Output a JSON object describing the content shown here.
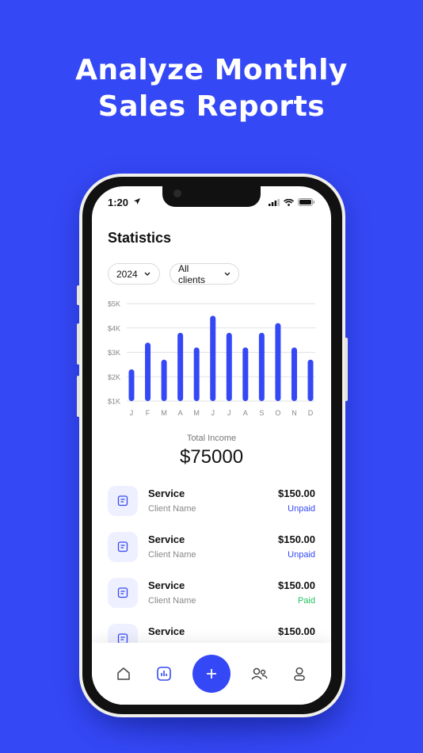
{
  "headline": {
    "line1": "Analyze Monthly",
    "line2": "Sales Reports"
  },
  "status_bar": {
    "time": "1:20"
  },
  "screen": {
    "title": "Statistics",
    "filters": {
      "year": "2024",
      "clients": "All clients"
    }
  },
  "chart_data": {
    "type": "bar",
    "categories": [
      "J",
      "F",
      "M",
      "A",
      "M",
      "J",
      "J",
      "A",
      "S",
      "O",
      "N",
      "D"
    ],
    "values": [
      2.3,
      3.4,
      2.7,
      3.8,
      3.2,
      4.5,
      3.8,
      3.2,
      3.8,
      4.2,
      3.2,
      2.7
    ],
    "y_ticks": [
      "$1K",
      "$2K",
      "$3K",
      "$4K",
      "$5K"
    ],
    "ylim": [
      1,
      5
    ],
    "grid": true,
    "bar_color": "#3548f5"
  },
  "summary": {
    "label": "Total Income",
    "value": "$75000"
  },
  "transactions": [
    {
      "title": "Service",
      "client": "Client Name",
      "amount": "$150.00",
      "status": "Unpaid"
    },
    {
      "title": "Service",
      "client": "Client Name",
      "amount": "$150.00",
      "status": "Unpaid"
    },
    {
      "title": "Service",
      "client": "Client Name",
      "amount": "$150.00",
      "status": "Paid"
    },
    {
      "title": "Service",
      "client": "",
      "amount": "$150.00",
      "status": ""
    }
  ],
  "nav": {
    "items": [
      "home-icon",
      "statistics-icon",
      "add-icon",
      "clients-icon",
      "profile-icon"
    ],
    "active": "statistics-icon",
    "accent": "#3548f5"
  }
}
